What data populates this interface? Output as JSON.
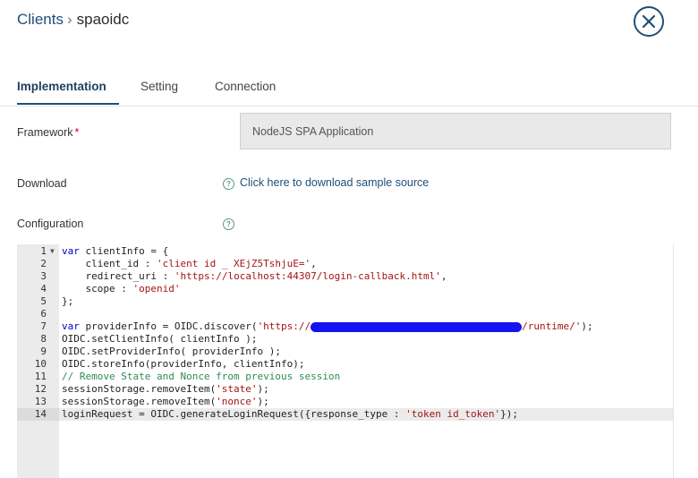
{
  "breadcrumb": {
    "parent": "Clients",
    "separator": "›",
    "current": "spaoidc"
  },
  "tabs": [
    {
      "label": "Implementation",
      "active": true
    },
    {
      "label": "Setting",
      "active": false
    },
    {
      "label": "Connection",
      "active": false
    }
  ],
  "form": {
    "framework_label": "Framework",
    "required_mark": "*",
    "framework_value": "NodeJS SPA Application",
    "download_label": "Download",
    "download_link": "Click here to download sample source",
    "configuration_label": "Configuration"
  },
  "editor": {
    "active_line": 14,
    "line_numbers": [
      "1",
      "2",
      "3",
      "4",
      "5",
      "6",
      "7",
      "8",
      "9",
      "10",
      "11",
      "12",
      "13",
      "14"
    ]
  },
  "colors": {
    "accent": "#1f4e79",
    "required": "#d0021b",
    "keyword": "#0000cc",
    "string": "#a31515",
    "comment": "#2e8b57",
    "redaction": "#1414f0"
  }
}
